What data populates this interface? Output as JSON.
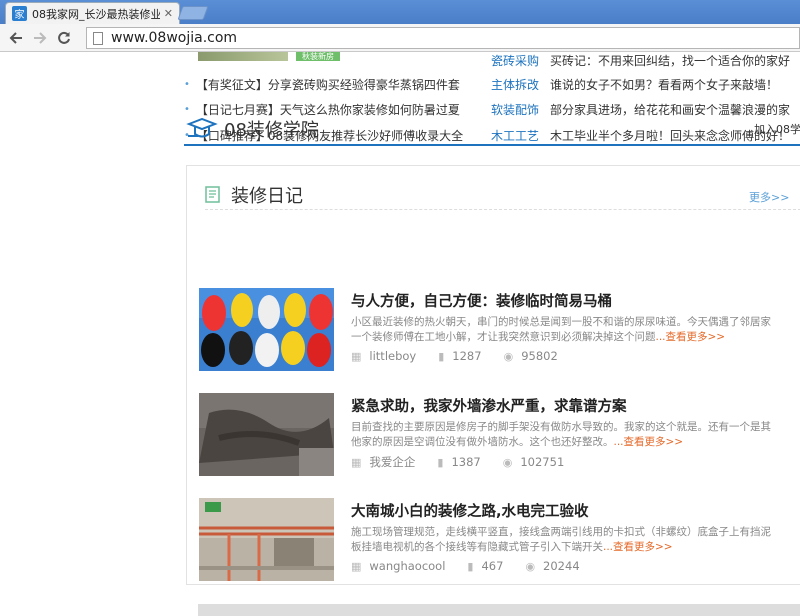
{
  "browser": {
    "tab_title": "08我家网_长沙最热装修业",
    "tab_favicon": "家",
    "tab_close": "✕",
    "url": "www.08wojia.com"
  },
  "top_badge": "秋装新房",
  "news": [
    {
      "left": "",
      "cat": "瓷砖采购",
      "right": "买砖记：不用来回纠结，找一个适合你的家好"
    },
    {
      "left": "【有奖征文】分享瓷砖购买经验得豪华蒸锅四件套",
      "cat": "主体拆改",
      "right": "谁说的女子不如男？看看两个女子来敲墙！"
    },
    {
      "left": "【日记七月赛】天气这么热你家装修如何防暑过夏",
      "cat": "软装配饰",
      "right": "部分家具进场，给花花和画安个温馨浪漫的家"
    },
    {
      "left": "【口碑推荐】08装修网友推荐长沙好师傅收录大全",
      "cat": "木工工艺",
      "right": "木工毕业半个多月啦！回头来念念师傅的好！"
    }
  ],
  "academy": {
    "title": "08装修学院",
    "join": "加入08学"
  },
  "diary": {
    "title": "装修日记",
    "more": "更多>>",
    "articles": [
      {
        "title": "与人方便，自己方便：装修临时简易马桶",
        "desc": "小区最近装修的热火朝天，串门的时候总是闻到一股不和谐的尿尿味道。今天偶遇了邻居家一个装修师傅在工地小解，才让我突然意识到必须解决掉这个问题",
        "readmore": "...查看更多>>",
        "author": "littleboy",
        "comments": "1287",
        "views": "95802"
      },
      {
        "title": "紧急求助，我家外墙渗水严重，求靠谱方案",
        "desc": "目前查找的主要原因是修房子的脚手架没有做防水导致的。我家的这个就是。还有一个是其他家的原因是空调位没有做外墙防水。这个也还好整改。",
        "readmore": "...查看更多>>",
        "author": "我爱企企",
        "comments": "1387",
        "views": "102751"
      },
      {
        "title": "大南城小白的装修之路,水电完工验收",
        "desc": "施工现场管理规范，走线横平竖直，接线盒两端引线用的卡扣式（非螺纹）底盒子上有挡泥板挂墙电视机的各个接线等有隐藏式管子引入下端开关",
        "readmore": "...查看更多>>",
        "author": "wanghaocool",
        "comments": "467",
        "views": "20244"
      }
    ]
  },
  "colors": {
    "accent_blue": "#1e73be",
    "readmore_orange": "#e46a2a",
    "tabstrip_blue": "#4a7fc8"
  },
  "icons": {
    "back": "arrow-left-icon",
    "forward": "arrow-right-icon",
    "reload": "reload-icon",
    "calendar": "calendar-icon",
    "comment": "comment-icon",
    "eye": "eye-icon"
  }
}
